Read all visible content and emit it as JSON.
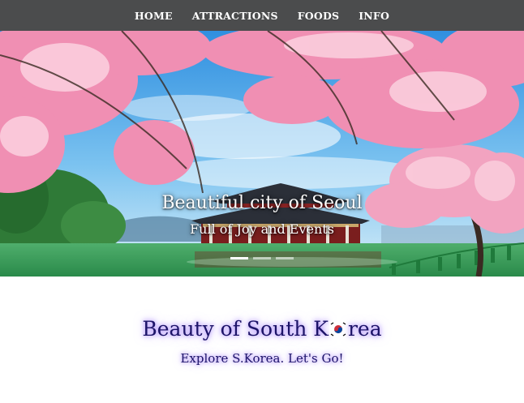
{
  "nav": {
    "items": [
      {
        "label": "HOME"
      },
      {
        "label": "ATTRACTIONS"
      },
      {
        "label": "FOODS"
      },
      {
        "label": "INFO"
      }
    ]
  },
  "hero": {
    "caption_title": "Beautiful city of Seoul",
    "caption_subtitle": "Full of Joy and Events",
    "slides_count": 3,
    "active_slide": 1
  },
  "intro": {
    "title_before": "Beauty of South K",
    "title_after": "rea",
    "title_flag_icon": "south-korea-flag-icon",
    "subtitle": "Explore S.Korea. Let's Go!"
  },
  "colors": {
    "navbar": "#4b4c4d",
    "heading": "#1d1468",
    "glow": "#9a6eff"
  }
}
